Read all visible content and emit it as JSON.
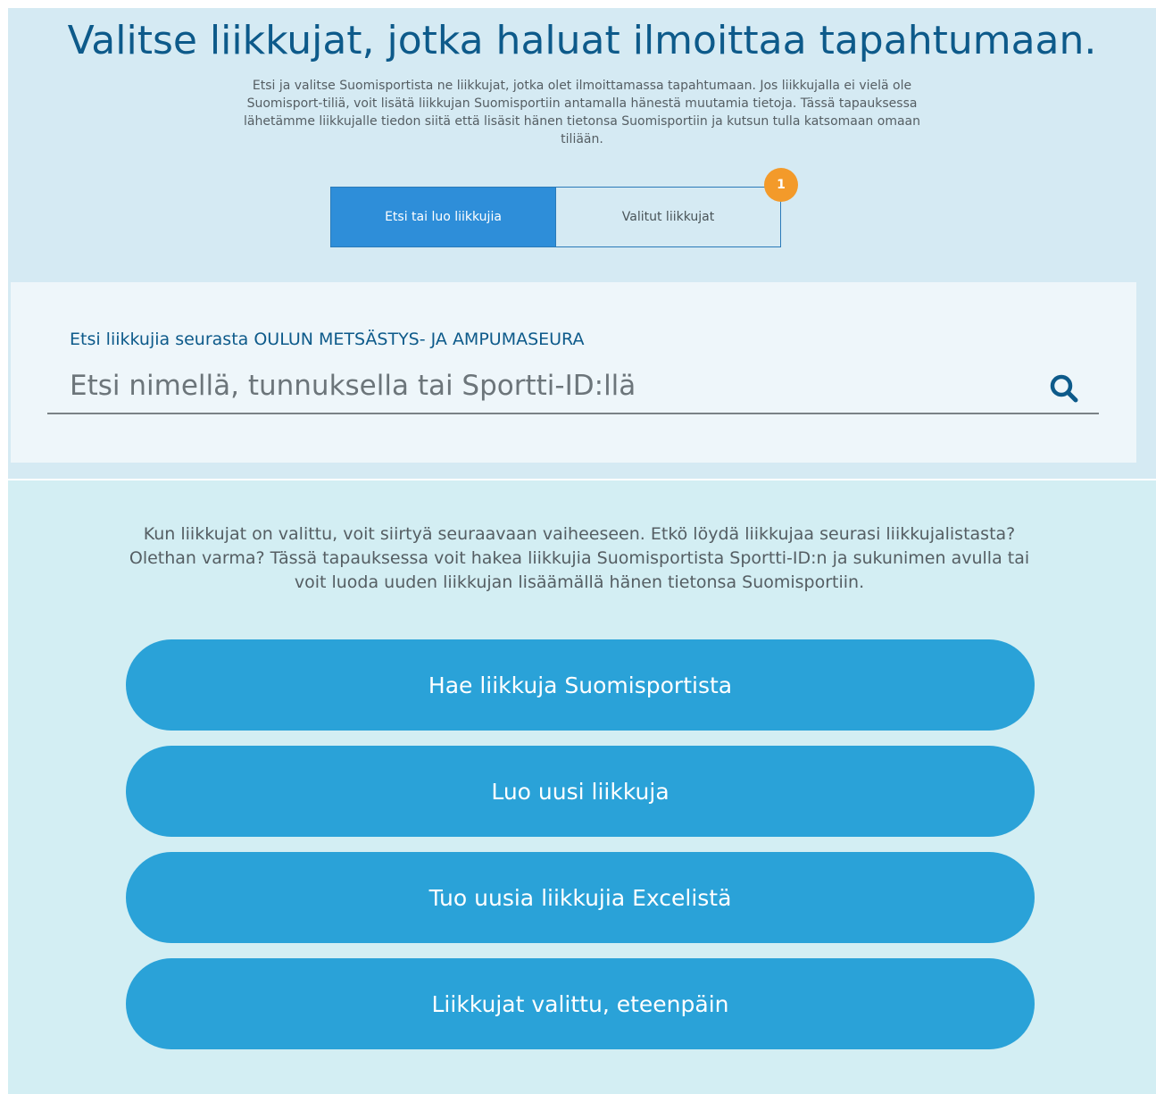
{
  "header": {
    "title": "Valitse liikkujat, jotka haluat ilmoittaa tapahtumaan.",
    "description": "Etsi ja valitse Suomisportista ne liikkujat, jotka olet ilmoittamassa tapahtumaan. Jos liikkujalla ei vielä ole Suomisport-tiliä, voit lisätä liikkujan Suomisportiin antamalla hänestä muutamia tietoja. Tässä tapauksessa lähetämme liikkujalle tiedon siitä että lisäsit hänen tietonsa Suomisportiin ja kutsun tulla katsomaan omaan tiliään."
  },
  "tabs": [
    {
      "label": "Etsi tai luo liikkujia",
      "active": true
    },
    {
      "label": "Valitut liikkujat",
      "active": false,
      "badge": "1"
    }
  ],
  "search": {
    "label": "Etsi liikkujia seurasta OULUN METSÄSTYS- JA AMPUMASEURA",
    "placeholder": "Etsi nimellä, tunnuksella tai Sportti-ID:llä",
    "icon": "search-icon"
  },
  "info_text": "Kun liikkujat on valittu, voit siirtyä seuraavaan vaiheeseen. Etkö löydä liikkujaa seurasi liikkujalistasta? Olethan varma? Tässä tapauksessa voit hakea liikkujia Suomisportista Sportti-ID:n ja sukunimen avulla tai voit luoda uuden liikkujan lisäämällä hänen tietonsa Suomisportiin.",
  "buttons": [
    {
      "label": "Hae liikkuja Suomisportista"
    },
    {
      "label": "Luo uusi liikkuja"
    },
    {
      "label": "Tuo uusia liikkujia Excelistä"
    },
    {
      "label": "Liikkujat valittu, eteenpäin"
    }
  ],
  "colors": {
    "primary": "#2e8ed9",
    "button": "#2aa2d8",
    "title": "#0d5a8a",
    "badge": "#f39a2a"
  }
}
